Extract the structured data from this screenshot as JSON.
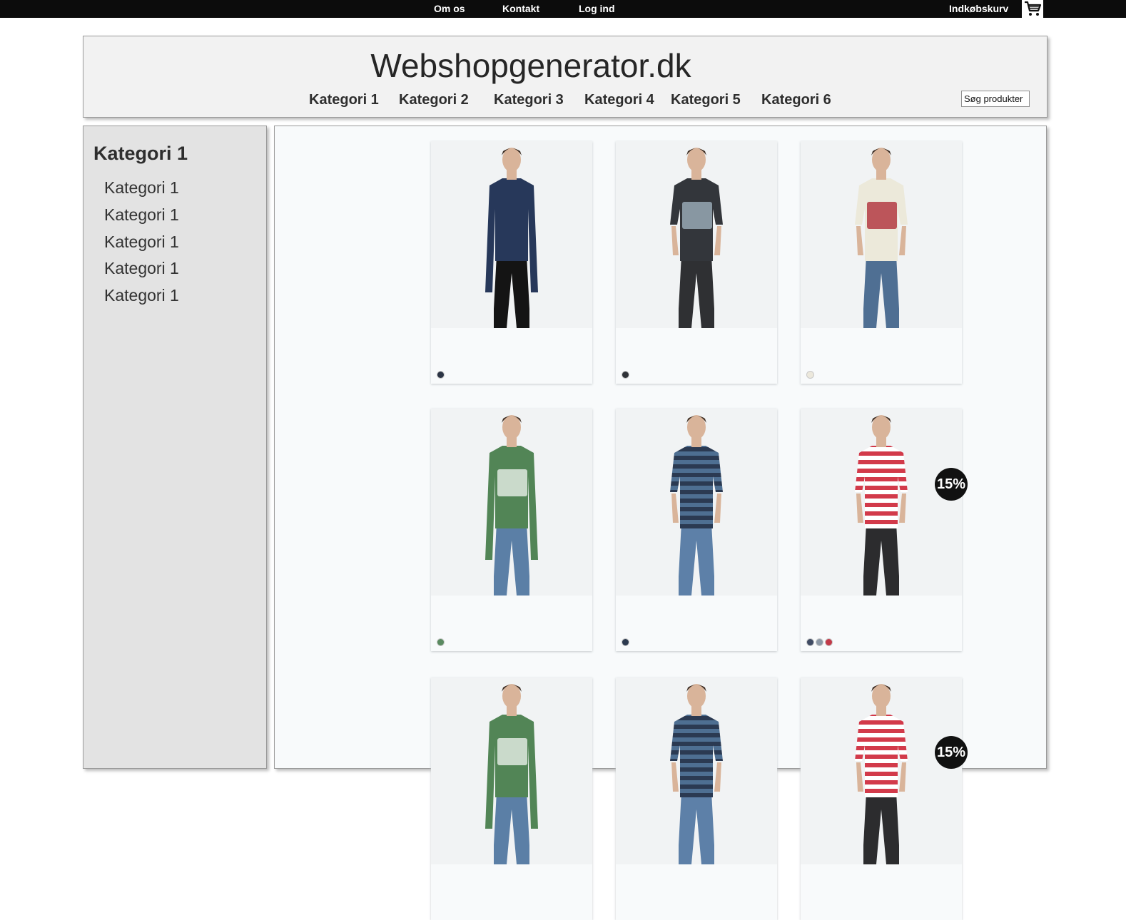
{
  "topbar": {
    "links": [
      "Om os",
      "Kontakt",
      "Log ind"
    ],
    "cart_label": "Indkøbskurv",
    "cart_icon": "shopping-cart-icon"
  },
  "header": {
    "title": "Webshopgenerator.dk",
    "categories": [
      "Kategori 1",
      "Kategori 2",
      "Kategori 3",
      "Kategori 4",
      "Kategori 5",
      "Kategori 6"
    ],
    "search_placeholder": "Søg produkter"
  },
  "sidebar": {
    "title": "Kategori 1",
    "items": [
      "Kategori 1",
      "Kategori 1",
      "Kategori 1",
      "Kategori 1",
      "Kategori 1"
    ]
  },
  "products": [
    {
      "image": "man-navy-henley-longsleeve",
      "top": "navy henley",
      "swatches": [
        "#2b3445"
      ]
    },
    {
      "image": "man-dark-print-tshirt",
      "top": "dark print tee",
      "swatches": [
        "#2f3237"
      ]
    },
    {
      "image": "man-cream-fairbanks-alaska-tshirt",
      "top": "cream print tee",
      "swatches": [
        "#ece8dc"
      ]
    },
    {
      "image": "man-green-layered-print-tshirt",
      "top": "green layered tee",
      "swatches": [
        "#5a8a60"
      ]
    },
    {
      "image": "man-navy-striped-polo",
      "top": "navy striped polo",
      "swatches": [
        "#2c3a4f"
      ]
    },
    {
      "image": "man-red-white-striped-tshirt",
      "top": "red striped tee",
      "swatches": [
        "#3f4b63",
        "#8c98a6",
        "#c23a48"
      ],
      "discount": "15%"
    },
    {
      "image": "man-green-layered-print-tshirt",
      "top": "green layered tee",
      "swatches": []
    },
    {
      "image": "man-navy-striped-polo",
      "top": "navy striped polo",
      "swatches": []
    },
    {
      "image": "man-red-white-striped-tshirt",
      "top": "red striped tee",
      "swatches": []
    }
  ],
  "colors": {
    "topbar": "#0c0c0c",
    "header_bg": "#f2f2f2",
    "sidebar_bg": "#e3e3e3",
    "main_bg": "#f8fafb",
    "badge": "#111111"
  }
}
